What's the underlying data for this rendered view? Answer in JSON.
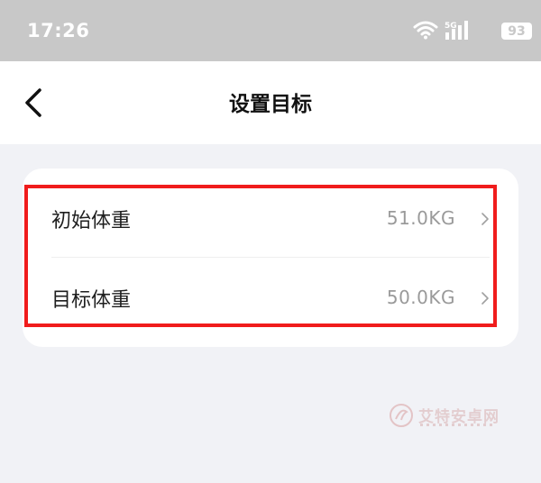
{
  "status_bar": {
    "time": "17:26",
    "network_label": "5G",
    "battery": "93"
  },
  "header": {
    "title": "设置目标",
    "back_icon": "chevron-left-icon"
  },
  "settings": [
    {
      "label": "初始体重",
      "value": "51.0KG",
      "icon": "chevron-right-icon"
    },
    {
      "label": "目标体重",
      "value": "50.0KG",
      "icon": "chevron-right-icon"
    }
  ],
  "watermark": {
    "text": "艾特安卓网"
  },
  "colors": {
    "highlight": "#f01c1c",
    "page_background": "#f1f2f6",
    "status_bar": "#c8c8c8"
  }
}
